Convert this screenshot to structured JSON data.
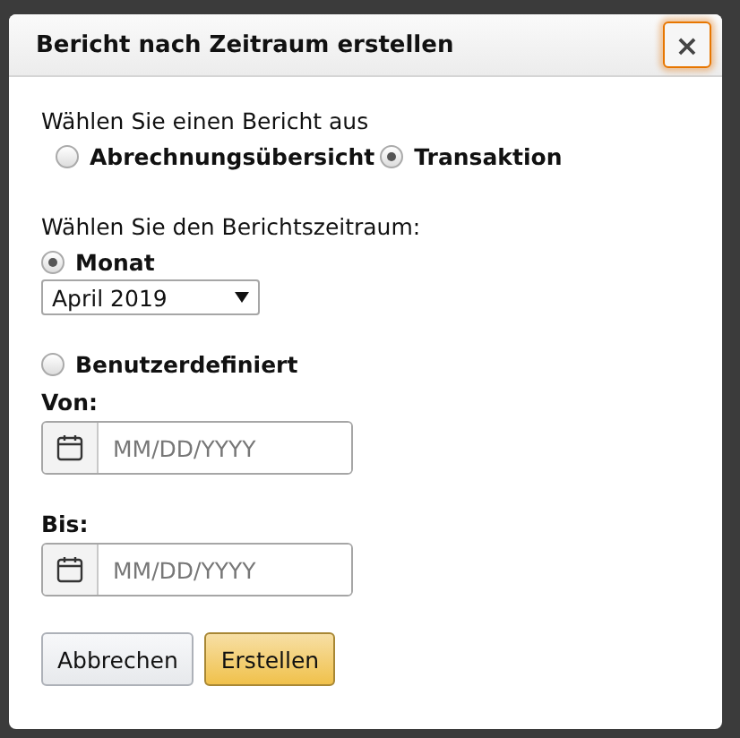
{
  "dialog": {
    "title": "Bericht nach Zeitraum erstellen",
    "close": "×"
  },
  "report": {
    "label": "Wählen Sie einen Bericht aus",
    "options": [
      {
        "label": "Abrechnungsübersicht",
        "selected": false
      },
      {
        "label": "Transaktion",
        "selected": true
      }
    ]
  },
  "period": {
    "label": "Wählen Sie den Berichtszeitraum:",
    "month": {
      "label": "Monat",
      "selected": true,
      "value": "April 2019"
    },
    "custom": {
      "label": "Benutzerdefiniert",
      "selected": false,
      "fields": [
        {
          "label": "Von:",
          "placeholder": "MM/DD/YYYY"
        },
        {
          "label": "Bis:",
          "placeholder": "MM/DD/YYYY"
        }
      ]
    }
  },
  "buttons": [
    {
      "label": "Abbrechen",
      "kind": "secondary"
    },
    {
      "label": "Erstellen",
      "kind": "primary"
    }
  ]
}
